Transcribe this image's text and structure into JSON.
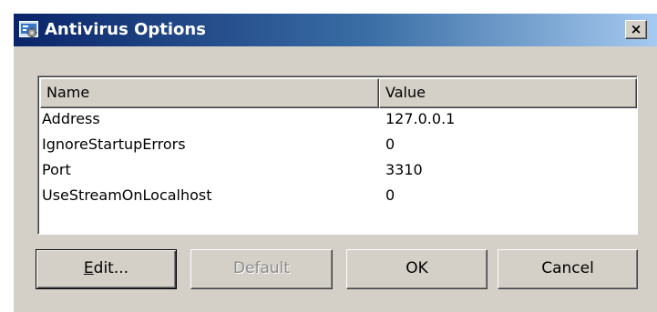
{
  "window": {
    "title": "Antivirus Options",
    "icon": "antivirus-options-icon",
    "close_label": "×"
  },
  "list": {
    "columns": [
      "Name",
      "Value"
    ],
    "rows": [
      {
        "name": "Address",
        "value": "127.0.0.1"
      },
      {
        "name": "IgnoreStartupErrors",
        "value": "0"
      },
      {
        "name": "Port",
        "value": "3310"
      },
      {
        "name": "UseStreamOnLocalhost",
        "value": "0"
      }
    ]
  },
  "buttons": {
    "edit_mnemonic": "E",
    "edit_rest": "dit...",
    "default": "Default",
    "ok": "OK",
    "cancel": "Cancel"
  },
  "colors": {
    "face": "#d4d0c8",
    "title_start": "#0a246a",
    "title_end": "#a6caf0",
    "disabled_text": "#8c8c8c"
  }
}
